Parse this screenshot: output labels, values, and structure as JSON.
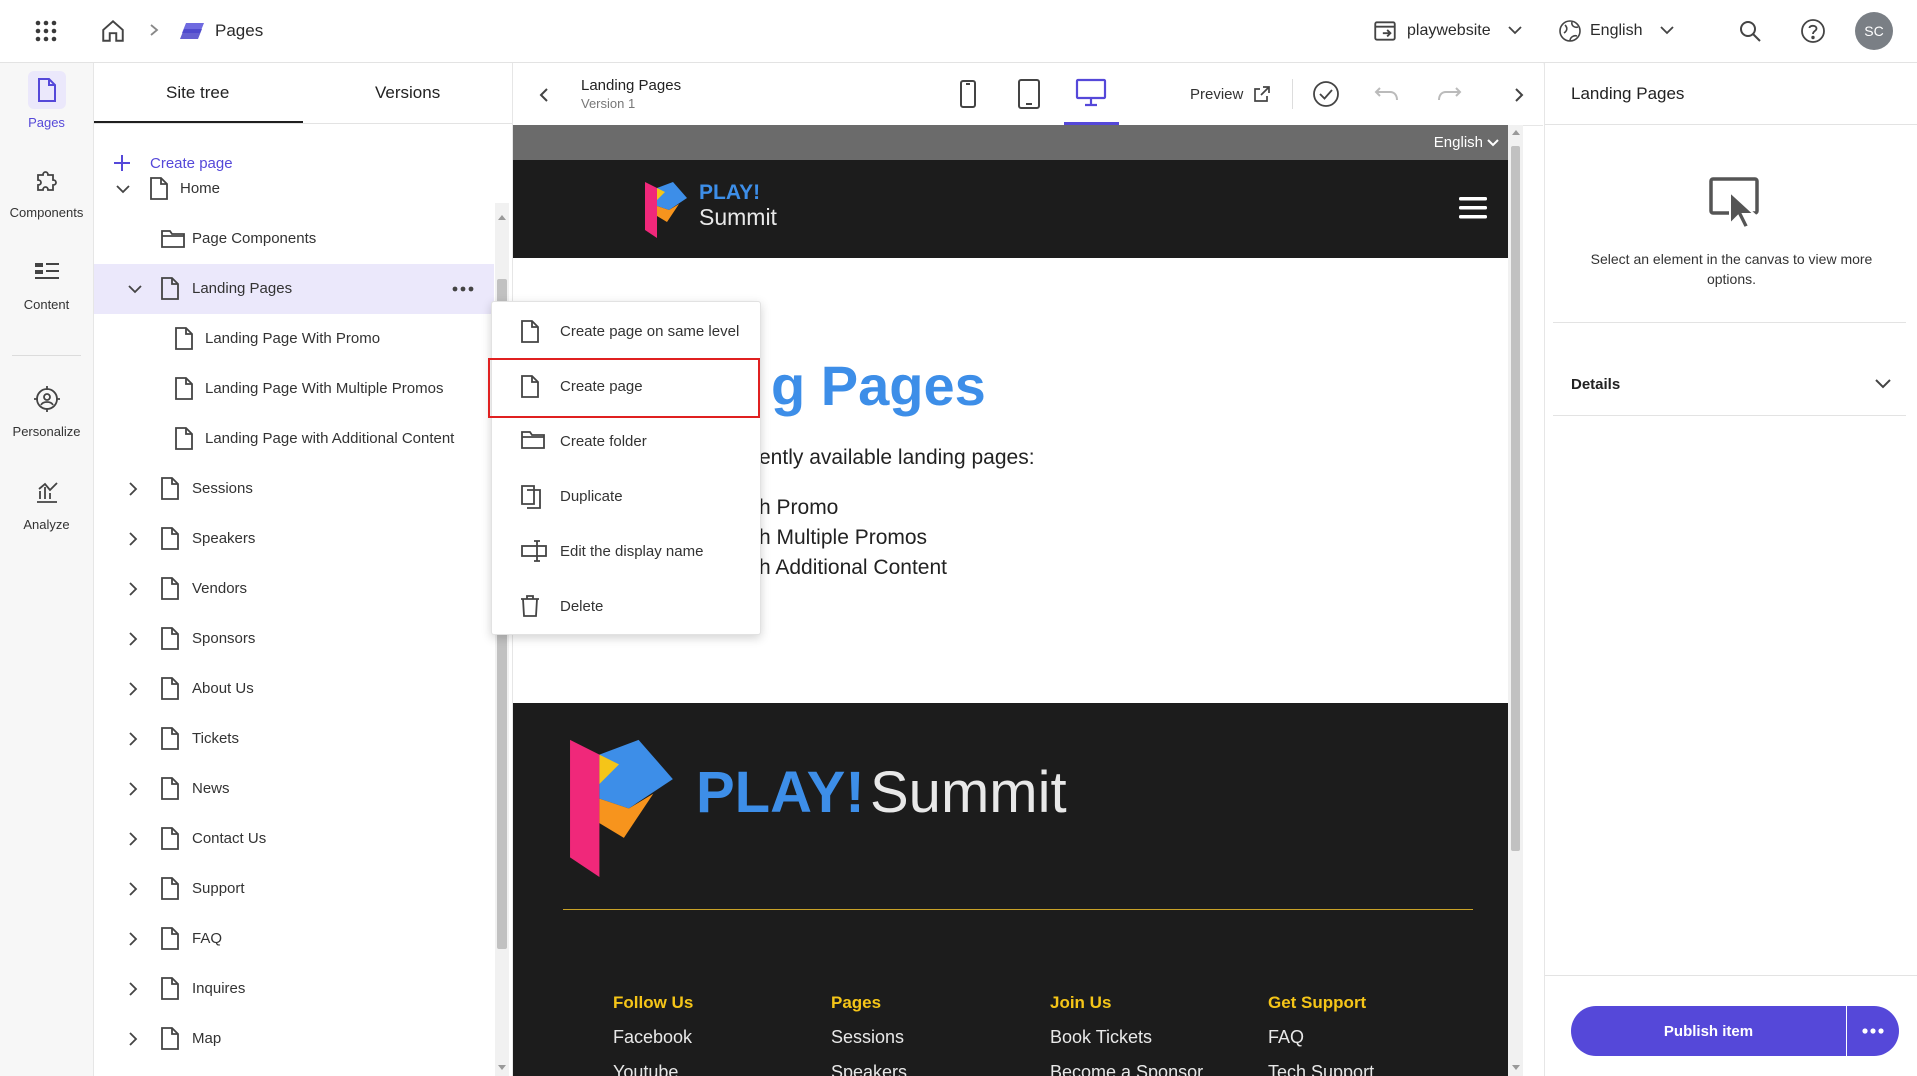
{
  "header": {
    "breadcrumb_title": "Pages",
    "site": "playwebsite",
    "language": "English",
    "avatar": "SC"
  },
  "rail": {
    "items": [
      {
        "label": "Pages"
      },
      {
        "label": "Components"
      },
      {
        "label": "Content"
      },
      {
        "label": "Personalize"
      },
      {
        "label": "Analyze"
      }
    ]
  },
  "tree_panel": {
    "tabs": [
      "Site tree",
      "Versions"
    ],
    "create_page": "Create page",
    "items": [
      {
        "label": "Home"
      },
      {
        "label": "Page Components"
      },
      {
        "label": "Landing Pages"
      },
      {
        "label": "Landing Page With Promo"
      },
      {
        "label": "Landing Page With Multiple Promos"
      },
      {
        "label": "Landing Page with Additional Content"
      },
      {
        "label": "Sessions"
      },
      {
        "label": "Speakers"
      },
      {
        "label": "Vendors"
      },
      {
        "label": "Sponsors"
      },
      {
        "label": "About Us"
      },
      {
        "label": "Tickets"
      },
      {
        "label": "News"
      },
      {
        "label": "Contact Us"
      },
      {
        "label": "Support"
      },
      {
        "label": "FAQ"
      },
      {
        "label": "Inquires"
      },
      {
        "label": "Map"
      }
    ]
  },
  "context_menu": {
    "items": [
      {
        "label": "Create page on same level",
        "icon": "page-icon"
      },
      {
        "label": "Create page",
        "icon": "page-icon"
      },
      {
        "label": "Create folder",
        "icon": "folder-icon"
      },
      {
        "label": "Duplicate",
        "icon": "duplicate-icon"
      },
      {
        "label": "Edit the display name",
        "icon": "rename-icon"
      },
      {
        "label": "Delete",
        "icon": "trash-icon"
      }
    ]
  },
  "canvas_bar": {
    "title": "Landing Pages",
    "version": "Version 1",
    "preview": "Preview"
  },
  "site_preview": {
    "language": "English",
    "logo_play": "PLAY!",
    "logo_summit": "Summit",
    "heading_partial": "g Pages",
    "intro_partial": "ently available landing pages:",
    "list_partial": [
      "h Promo",
      "h Multiple Promos",
      "h Additional Content"
    ],
    "footer_logo_play": "PLAY!",
    "footer_logo_summit": "Summit",
    "footer_columns": [
      {
        "heading": "Follow Us",
        "links": [
          "Facebook",
          "Youtube"
        ]
      },
      {
        "heading": "Pages",
        "links": [
          "Sessions",
          "Speakers"
        ]
      },
      {
        "heading": "Join Us",
        "links": [
          "Book Tickets",
          "Become a Sponsor"
        ]
      },
      {
        "heading": "Get Support",
        "links": [
          "FAQ",
          "Tech Support"
        ]
      }
    ]
  },
  "right_panel": {
    "title": "Landing Pages",
    "hint": "Select an element in the canvas to view more options.",
    "details": "Details",
    "publish": "Publish item"
  },
  "colors": {
    "accent": "#5548d9",
    "site_blue": "#3d8ee8",
    "footer_yellow": "#f5c518",
    "dark": "#1c1c1c",
    "highlight_red": "#e02020"
  }
}
